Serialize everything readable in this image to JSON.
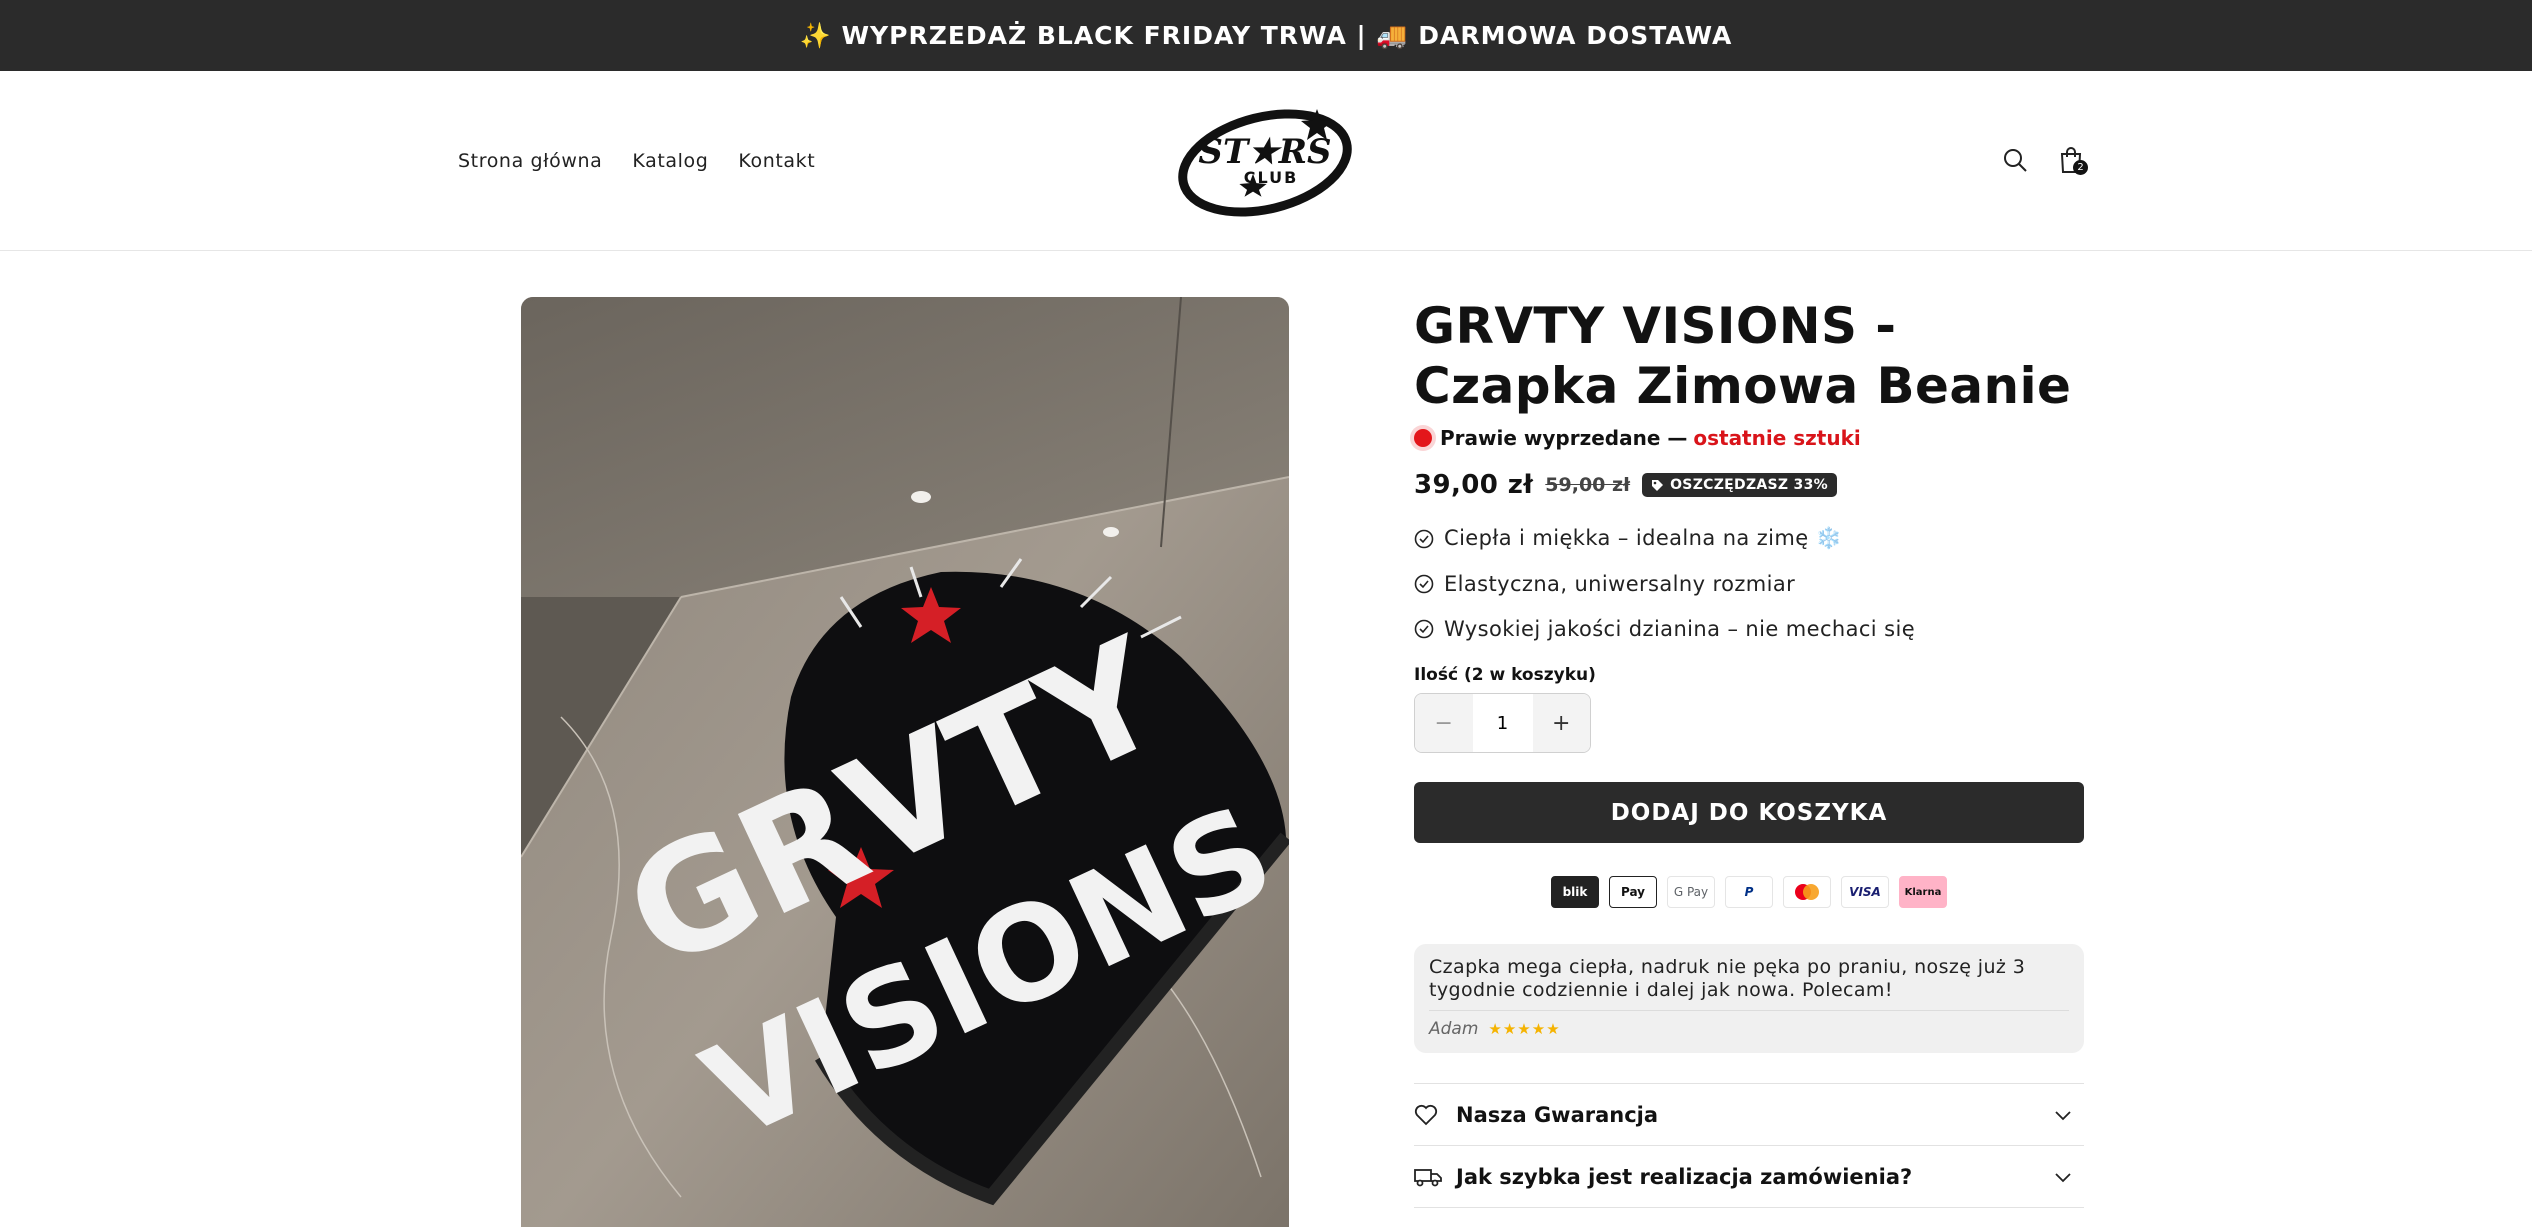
{
  "announcement": {
    "text": "✨ WYPRZEDAŻ BLACK FRIDAY TRWA | 🚚 DARMOWA DOSTAWA"
  },
  "header": {
    "nav": [
      "Strona główna",
      "Katalog",
      "Kontakt"
    ],
    "logo": {
      "top": "ST★RS",
      "bottom": "CLUB"
    },
    "cart_count": "2",
    "icons": [
      "search-icon",
      "shopping-bag-icon"
    ]
  },
  "product": {
    "image_text": {
      "line1": "GRVTY",
      "line2": "VISIONS"
    },
    "title": "GRVTY VISIONS - Czapka Zimowa Beanie",
    "stock": {
      "prefix": "Prawie wyprzedane —",
      "highlight": "ostatnie sztuki"
    },
    "price": "39,00 zł",
    "compare_price": "59,00 zł",
    "save_badge": "OSZCZĘDZASZ 33%",
    "features": [
      "Ciepła i miękka – idealna na zimę ❄️",
      "Elastyczna, uniwersalny rozmiar",
      "Wysokiej jakości dzianina – nie mechaci się"
    ],
    "quantity_label": "Ilość (2 w koszyku)",
    "quantity": "1",
    "add_to_cart": "DODAJ DO KOSZYKA",
    "payments": [
      "blik",
      "Pay",
      "G Pay",
      "P",
      "",
      "VISA",
      "Klarna"
    ]
  },
  "review": {
    "text": "Czapka mega ciepła, nadruk nie pęka po praniu, noszę już 3 tygodnie codziennie i dalej jak nowa. Polecam!",
    "author": "Adam",
    "stars": "★★★★★"
  },
  "accordion": [
    "Nasza Gwarancja",
    "Jak szybka jest realizacja zamówienia?"
  ],
  "colors": {
    "dark": "#2b2b2b",
    "accent_red": "#d9141a",
    "star_gold": "#f5b301"
  }
}
